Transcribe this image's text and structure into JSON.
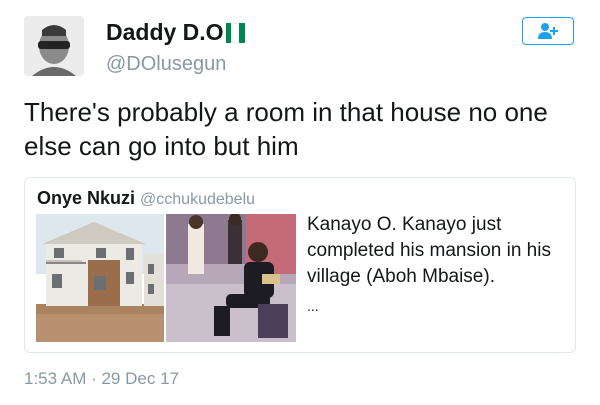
{
  "author": {
    "display_name": "Daddy D.O",
    "handle": "@DOlusegun",
    "flag_colors": [
      "#008751",
      "#ffffff",
      "#008751"
    ]
  },
  "follow_button": {
    "icon": "add-user-icon"
  },
  "tweet": {
    "text": "There's probably a room in that house no one else can go into but him"
  },
  "quoted_tweet": {
    "author_name": "Onye Nkuzi",
    "author_handle": "@cchukudebelu",
    "text": "Kanayo O. Kanayo just completed his mansion in his village (Aboh Mbaise).",
    "ellipsis": "...",
    "images": [
      "mansion-photo",
      "man-seated-photo"
    ]
  },
  "timestamp": "1:53 AM · 29 Dec 17",
  "colors": {
    "accent": "#1da1f2",
    "muted": "#8899a6",
    "border": "#e1e8ed"
  }
}
